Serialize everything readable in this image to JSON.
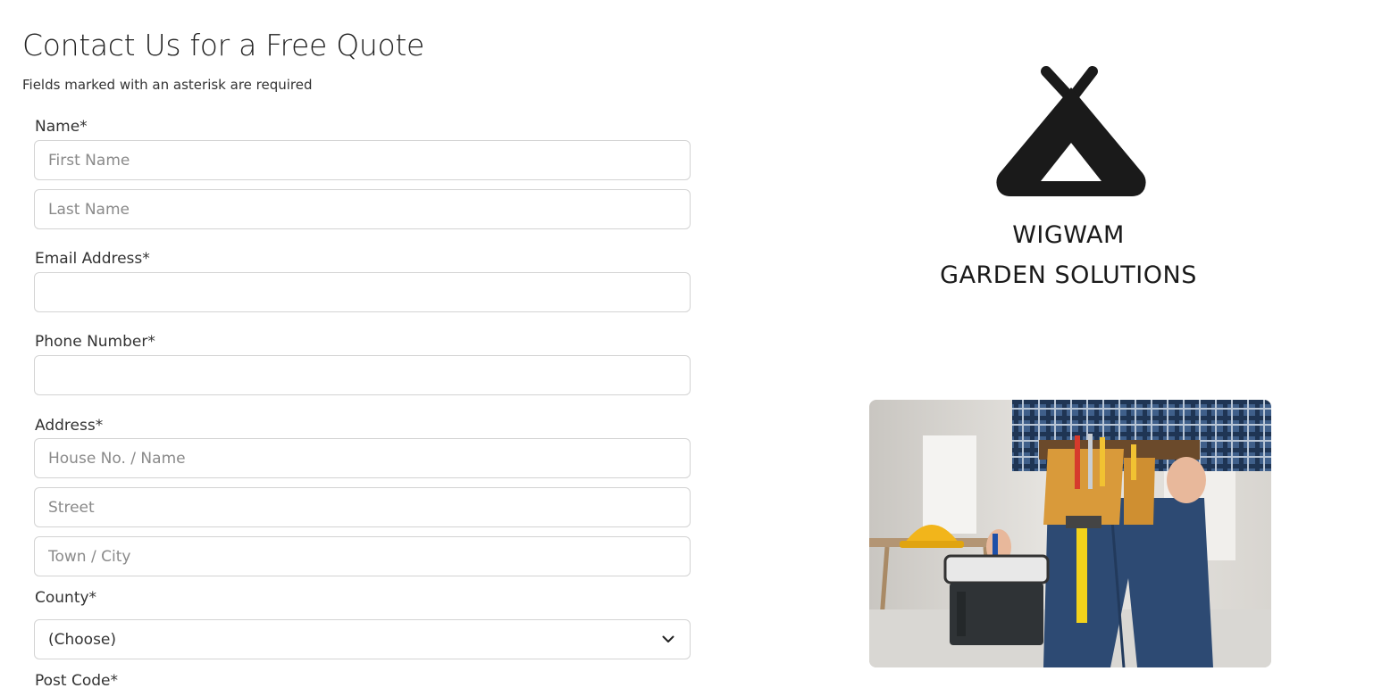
{
  "header": {
    "title": "Contact Us for a Free Quote",
    "required_note": "Fields marked with an asterisk are required"
  },
  "form": {
    "name": {
      "label": "Name*",
      "first_placeholder": "First Name",
      "first_value": "",
      "last_placeholder": "Last Name",
      "last_value": ""
    },
    "email": {
      "label": "Email Address*",
      "placeholder": "",
      "value": ""
    },
    "phone": {
      "label": "Phone Number*",
      "placeholder": "",
      "value": ""
    },
    "address": {
      "label": "Address*",
      "house_placeholder": "House No. / Name",
      "street_placeholder": "Street",
      "town_placeholder": "Town / City"
    },
    "county": {
      "label": "County*",
      "selected": "(Choose)"
    },
    "postcode": {
      "label": "Post Code*"
    }
  },
  "brand": {
    "line1": "WIGWAM",
    "line2": "GARDEN SOLUTIONS",
    "logo_icon": "wigwam-tent-icon",
    "logo_color": "#1a1a1a"
  },
  "photo": {
    "subject": "worker-with-tool-belt-image"
  },
  "colors": {
    "input_border": "#d3d3d3",
    "placeholder": "#8a8a8a",
    "text": "#333333"
  }
}
